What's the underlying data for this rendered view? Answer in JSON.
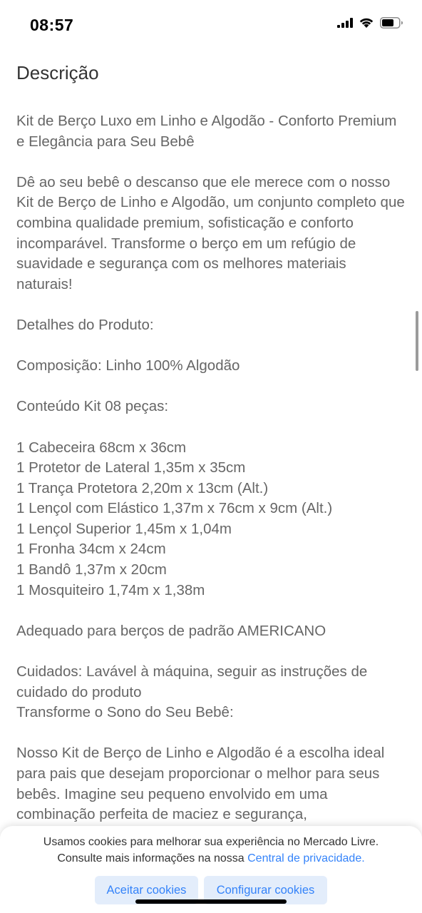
{
  "status_bar": {
    "time": "08:57",
    "icons": [
      "cellular-signal-icon",
      "wifi-icon",
      "battery-icon"
    ]
  },
  "section": {
    "title": "Descrição",
    "body": "Kit de Berço Luxo em Linho e Algodão - Conforto Premium e Elegância para Seu Bebê\n\nDê ao seu bebê o descanso que ele merece com o nosso Kit de Berço de Linho e Algodão, um conjunto completo que combina qualidade premium, sofisticação e conforto incomparável. Transforme o berço em um refúgio de suavidade e segurança com os melhores materiais naturais!\n\nDetalhes do Produto:\n\nComposição: Linho 100% Algodão\n\nConteúdo Kit 08 peças:\n\n1 Cabeceira 68cm x 36cm\n1 Protetor de Lateral 1,35m x 35cm\n1 Trança Protetora 2,20m x 13cm (Alt.)\n1 Lençol com Elástico 1,37m x 76cm x 9cm (Alt.)\n1 Lençol Superior 1,45m x 1,04m\n1 Fronha 34cm x 24cm\n1 Bandô 1,37m x 20cm\n1 Mosquiteiro 1,74m x 1,38m\n\nAdequado para berços de padrão AMERICANO\n\nCuidados: Lavável à máquina, seguir as instruções de cuidado do produto\nTransforme o Sono do Seu Bebê:\n\nNosso Kit de Berço de Linho e Algodão é a escolha ideal para pais que desejam proporcionar o melhor para seus bebês. Imagine seu pequeno envolvido em uma combinação perfeita de maciez e segurança,"
  },
  "cookie_banner": {
    "line1": "Usamos cookies para melhorar sua experiência no Mercado Livre.",
    "line2_prefix": "Consulte mais informações na nossa ",
    "privacy_link": "Central de privacidade.",
    "accept_label": "Aceitar cookies",
    "configure_label": "Configurar cookies"
  },
  "colors": {
    "text": "#666666",
    "title": "#333333",
    "accent": "#3483fa",
    "button_bg": "#e3edfb"
  }
}
